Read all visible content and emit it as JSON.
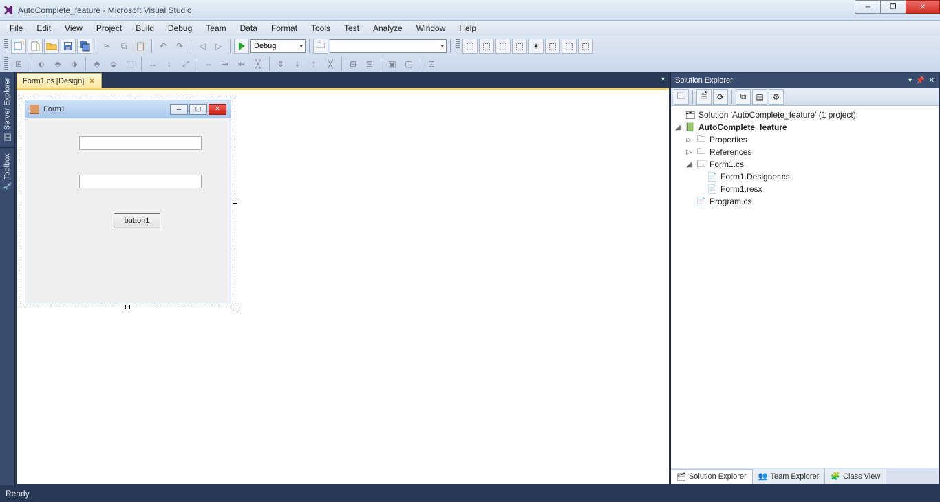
{
  "window": {
    "title": "AutoComplete_feature - Microsoft Visual Studio"
  },
  "menu": [
    "File",
    "Edit",
    "View",
    "Project",
    "Build",
    "Debug",
    "Team",
    "Data",
    "Format",
    "Tools",
    "Test",
    "Analyze",
    "Window",
    "Help"
  ],
  "toolbar": {
    "config": "Debug",
    "search": ""
  },
  "side_tabs": {
    "server_explorer": "Server Explorer",
    "toolbox": "Toolbox"
  },
  "document": {
    "tab": "Form1.cs [Design]"
  },
  "form": {
    "title": "Form1",
    "button1": "button1"
  },
  "solution_explorer": {
    "title": "Solution Explorer",
    "solution": "Solution 'AutoComplete_feature' (1 project)",
    "project": "AutoComplete_feature",
    "properties": "Properties",
    "references": "References",
    "form1": "Form1.cs",
    "form1_designer": "Form1.Designer.cs",
    "form1_resx": "Form1.resx",
    "program": "Program.cs"
  },
  "bottom_tabs": {
    "solution_explorer": "Solution Explorer",
    "team_explorer": "Team Explorer",
    "class_view": "Class View"
  },
  "status": {
    "ready": "Ready"
  }
}
